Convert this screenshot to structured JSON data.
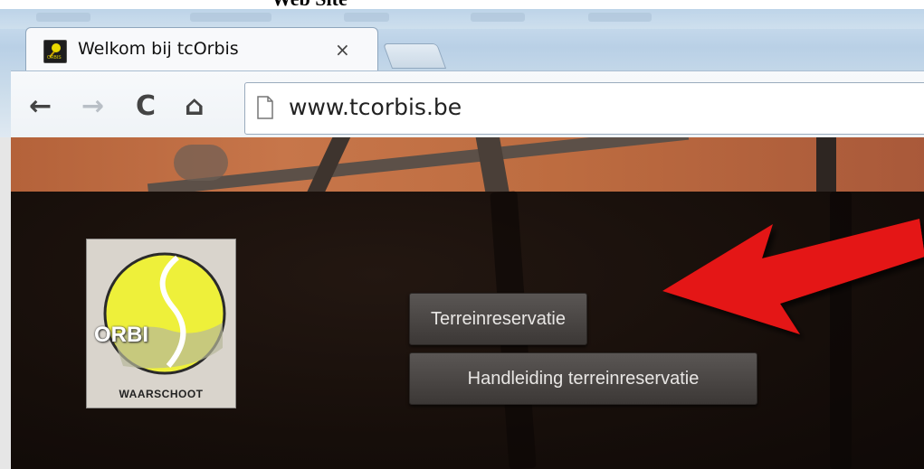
{
  "caption": "Web Site",
  "browser": {
    "tab_title": "Welkom bij tcOrbis",
    "tab_close": "×",
    "url": "www.tcorbis.be",
    "nav": {
      "back": "←",
      "forward": "→",
      "reload": "C",
      "home": "⌂"
    }
  },
  "page": {
    "logo": {
      "name": "ORBI",
      "subtitle": "WAARSCHOOT"
    },
    "buttons": [
      {
        "label": "Terreinreservatie"
      },
      {
        "label": "Handleiding terreinreservatie"
      }
    ],
    "annotation": {
      "type": "arrow-icon",
      "color": "#e41212"
    }
  }
}
